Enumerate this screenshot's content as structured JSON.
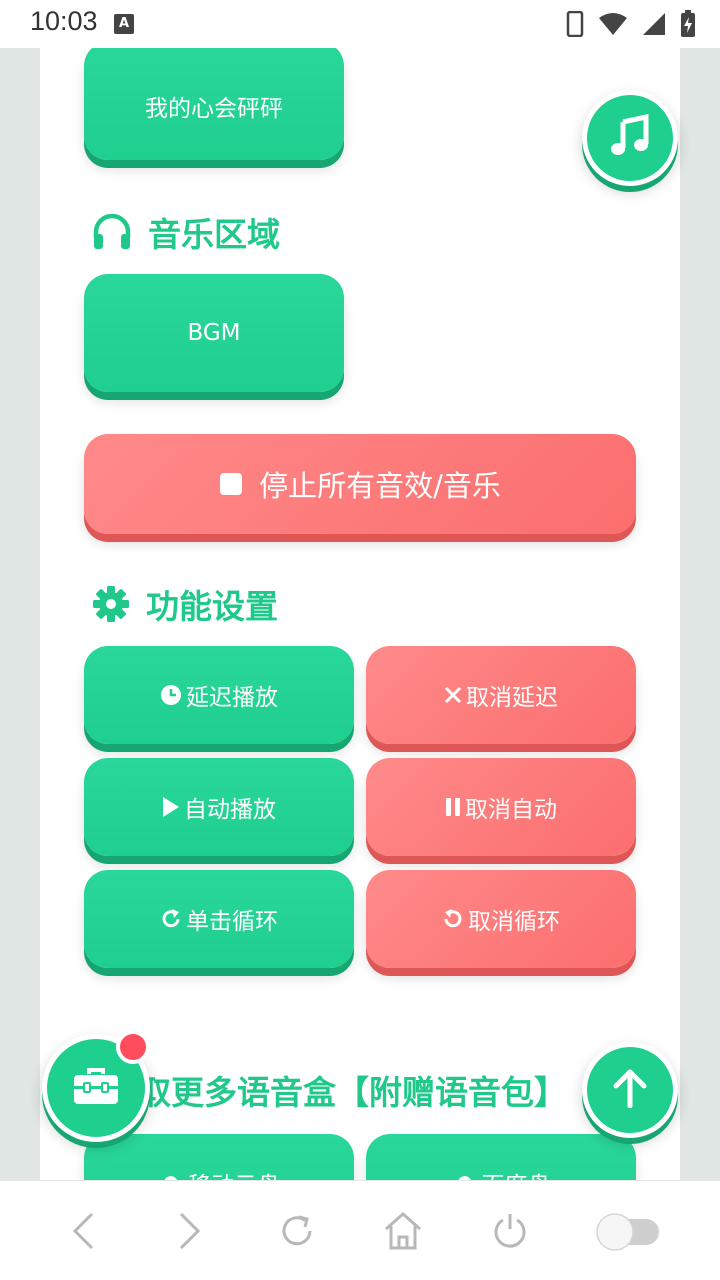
{
  "status_bar": {
    "time": "10:03",
    "notification_icon": "A"
  },
  "buttons": {
    "heartbeat": "我的心会砰砰",
    "bgm": "BGM",
    "stop_all": "停止所有音效/音乐",
    "delay_play": "延迟播放",
    "cancel_delay": "取消延迟",
    "auto_play": "自动播放",
    "cancel_auto": "取消自动",
    "single_loop": "单击循环",
    "cancel_loop": "取消循环",
    "mobile_cloud": "移动云盘",
    "baidu_cloud": "百度盘"
  },
  "sections": {
    "music": "音乐区域",
    "settings": "功能设置",
    "more": "取更多语音盒【附赠语音包】"
  },
  "colors": {
    "accent_green": "#1fcf8e",
    "accent_red": "#fb6e6e",
    "badge_red": "#ff4d5e"
  },
  "icons": {
    "music_fab": "music-note-icon",
    "toolbox_fab": "toolbox-icon",
    "back_to_top_fab": "arrow-up-icon"
  }
}
